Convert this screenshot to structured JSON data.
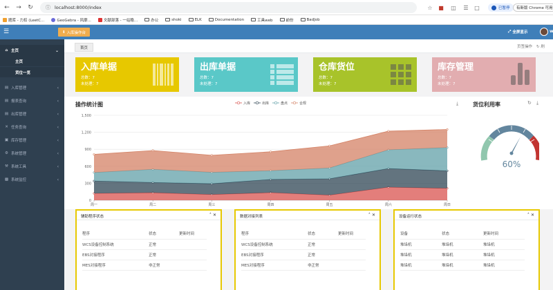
{
  "browser": {
    "url": "localhost:8000/index",
    "pause_label": "已暂停",
    "menu_label": "有新版 Chrome 可用",
    "bookmarks": [
      "题库 - 力扣 (LeetC...",
      "GeoGebra - 风靡...",
      "文献部落 - 一站稳...",
      "办公",
      "shoki",
      "ELK",
      "Documentation",
      "工具web",
      "前份",
      "BadJob"
    ]
  },
  "topbar": {
    "instock_button": "入库操作台",
    "fullscreen_label": "全屏显示",
    "user_initial": "w"
  },
  "sidebar": {
    "items": [
      {
        "label": "主页",
        "icon": "home-icon"
      },
      {
        "label": "入库管理",
        "icon": "inbox-icon"
      },
      {
        "label": "报表查询",
        "icon": "report-icon"
      },
      {
        "label": "出库管理",
        "icon": "outbox-icon"
      },
      {
        "label": "任务查询",
        "icon": "task-icon"
      },
      {
        "label": "库存管理",
        "icon": "inventory-icon"
      },
      {
        "label": "系统管理",
        "icon": "gear-icon"
      },
      {
        "label": "系统工具",
        "icon": "tool-icon"
      },
      {
        "label": "系统监控",
        "icon": "monitor-icon"
      }
    ],
    "subitems": [
      "主页",
      "货位一览"
    ]
  },
  "tabs": {
    "home": "首页",
    "page_ops": "页签操作",
    "refresh": "刷"
  },
  "cards": [
    {
      "title": "入库单据",
      "total": "总数：7",
      "pending": "未处理：7",
      "color": "#e7c800",
      "icon": "barcode-icon"
    },
    {
      "title": "出库单据",
      "total": "总数：7",
      "pending": "未处理：7",
      "color": "#5ac8c8",
      "icon": "list-icon"
    },
    {
      "title": "仓库货位",
      "total": "总数：7",
      "pending": "未处理：7",
      "color": "#a8c32a",
      "icon": "grid-icon"
    },
    {
      "title": "库存管理",
      "total": "总数：7",
      "pending": "未处理：7",
      "color": "#e2adb0",
      "icon": "bars-icon"
    }
  ],
  "op_chart_title": "操作统计图",
  "util_title": "货位利用率",
  "gauge_value": "60%",
  "chart_data": {
    "type": "area",
    "categories": [
      "周一",
      "周二",
      "周三",
      "周四",
      "周五",
      "周六",
      "周日"
    ],
    "yticks": [
      "0",
      "300",
      "600",
      "900",
      "1,200",
      "1,500"
    ],
    "ylim": [
      0,
      1500
    ],
    "stacked": true,
    "legend_position": "top",
    "series": [
      {
        "name": "入库",
        "color": "#d9534f",
        "values": [
          120,
          132,
          101,
          134,
          90,
          230,
          210
        ]
      },
      {
        "name": "出库",
        "color": "#2f4554",
        "values": [
          220,
          182,
          191,
          234,
          290,
          330,
          310
        ]
      },
      {
        "name": "盘点",
        "color": "#61a0a8",
        "values": [
          150,
          232,
          201,
          154,
          190,
          330,
          410
        ]
      },
      {
        "name": "合规",
        "color": "#d48265",
        "values": [
          320,
          332,
          301,
          334,
          390,
          330,
          320
        ]
      }
    ]
  },
  "boxes": [
    {
      "title": "辅助程序状态",
      "headers": [
        "程序",
        "状态",
        "更新时间"
      ],
      "rows": [
        [
          "WCS设备控制系统",
          "正常",
          ""
        ],
        [
          "EBS对接程序",
          "正常",
          ""
        ],
        [
          "MES对接程序",
          "非正常",
          ""
        ]
      ]
    },
    {
      "title": "数据对接列表",
      "headers": [
        "程序",
        "状态",
        "更新时间"
      ],
      "rows": [
        [
          "WCS设备控制系统",
          "正常",
          ""
        ],
        [
          "EBS对接程序",
          "正常",
          ""
        ],
        [
          "MES对接程序",
          "非正常",
          ""
        ]
      ]
    },
    {
      "title": "设备运行状态",
      "headers": [
        "设备",
        "状态",
        "更新时间"
      ],
      "rows": [
        [
          "堆垛机",
          "堆垛机",
          "堆垛机"
        ],
        [
          "堆垛机",
          "堆垛机",
          "堆垛机"
        ],
        [
          "堆垛机",
          "堆垛机",
          "堆垛机"
        ]
      ]
    }
  ]
}
